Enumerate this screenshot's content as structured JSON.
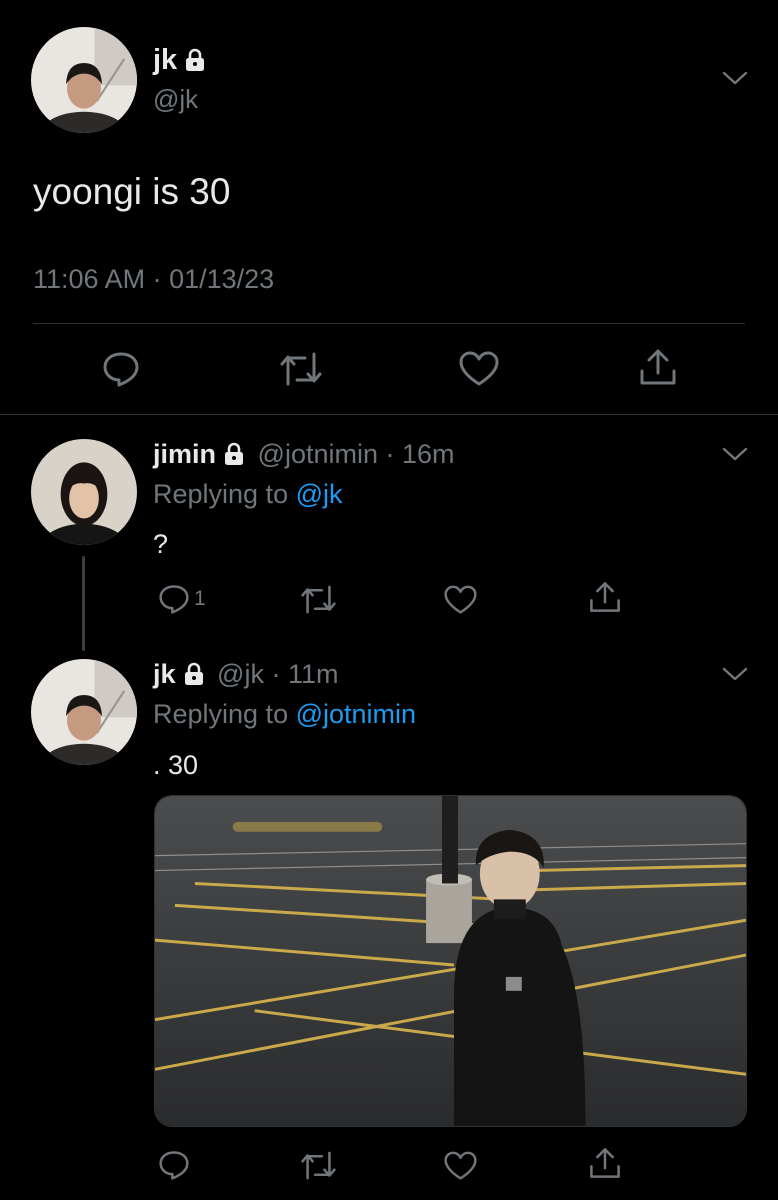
{
  "main_tweet": {
    "author_name": "jk",
    "author_handle": "@jk",
    "text": "yoongi is 30",
    "timestamp": "11:06 AM · 01/13/23",
    "locked": true,
    "icons": [
      "lock-icon",
      "chevron-down-icon",
      "reply-icon",
      "retweet-icon",
      "like-icon",
      "share-icon"
    ]
  },
  "replies": [
    {
      "author_name": "jimin",
      "author_handle": "@jotnimin",
      "time_ago": "· 16m",
      "replying_prefix": "Replying to",
      "replying_to": "@jk",
      "text": "?",
      "reply_count": "1",
      "locked": true
    },
    {
      "author_name": "jk",
      "author_handle": "@jk",
      "time_ago": "· 11m",
      "replying_prefix": "Replying to",
      "replying_to": "@jotnimin",
      "text": ". 30",
      "reply_count": "",
      "locked": true,
      "has_media": true
    }
  ],
  "colors": {
    "background": "#000000",
    "text_primary": "#e7e9ea",
    "text_secondary": "#71767b",
    "accent": "#1d9bf0",
    "divider": "#2f3336"
  }
}
